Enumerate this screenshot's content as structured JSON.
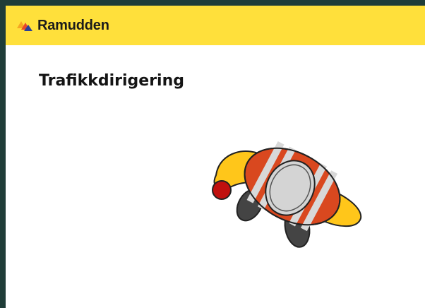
{
  "header": {
    "brand": "Ramudden",
    "background_color": "#ffe03b",
    "logo_icon": "ramudden-triangles-icon",
    "logo_colors": [
      "#e8472b",
      "#f5a623",
      "#2a3f9a"
    ]
  },
  "main": {
    "title": "Trafikkdirigering",
    "illustration": {
      "icon": "traffic-controller-hi-vis-vest-illustration",
      "colors": {
        "vest_orange": "#d9481f",
        "reflective_stripes": "#d8d8d8",
        "sleeves_yellow": "#ffc61a",
        "head_gray": "#d4d4d4",
        "baton_red": "#c0100e",
        "feet_dark": "#444444",
        "outline": "#222222"
      }
    }
  },
  "page": {
    "border_color": "#1f3d38"
  }
}
